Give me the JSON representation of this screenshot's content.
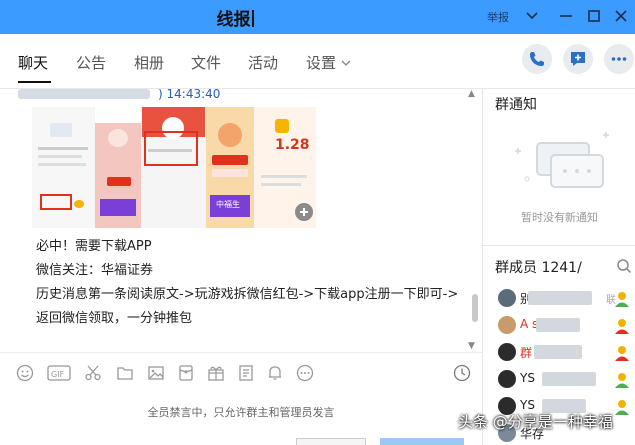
{
  "window": {
    "title": "线报",
    "report_label": "举报",
    "accent": "#3b9bff"
  },
  "tabs": [
    {
      "label": "聊天",
      "active": true
    },
    {
      "label": "公告"
    },
    {
      "label": "相册"
    },
    {
      "label": "文件"
    },
    {
      "label": "活动"
    },
    {
      "label": "设置"
    }
  ],
  "chat": {
    "timestamp": "14:43:40",
    "sender_suffix": ")",
    "message_lines": [
      "必中！需要下载APP",
      "微信关注：华福证券",
      "历史消息第一条阅读原文->玩游戏拆微信红包->下载app注册一下即可->",
      "返回微信领取，一分钟推包"
    ],
    "image_texts": {
      "lucky_draw": "中福生",
      "amount": "1.28"
    }
  },
  "input": {
    "muted_notice": "全员禁言中，只允许群主和管理员发言"
  },
  "sidebar": {
    "notice_title": "群通知",
    "notice_empty": "暂时没有新通知",
    "members_title": "群成员 1241",
    "members_suffix": "/",
    "members": [
      {
        "name": "别",
        "role": "联"
      },
      {
        "name": "A s",
        "red": true
      },
      {
        "name": "群",
        "red": true
      },
      {
        "name": "YS"
      },
      {
        "name": "YS"
      },
      {
        "name": "华存"
      }
    ]
  },
  "watermark": "头条 @分享是一种幸福"
}
